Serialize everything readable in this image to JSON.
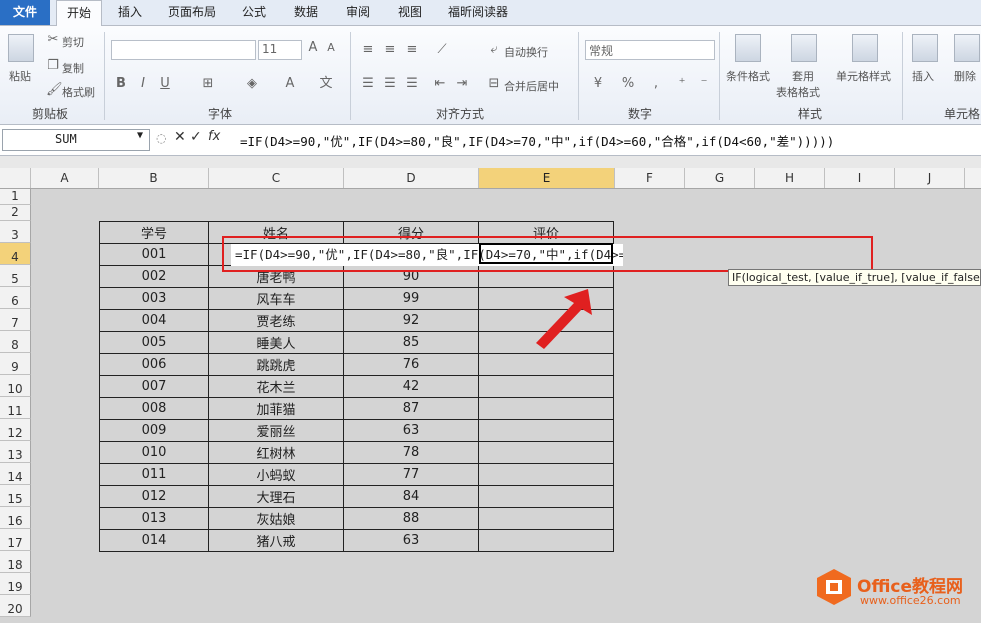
{
  "tabs": [
    "文件",
    "开始",
    "插入",
    "页面布局",
    "公式",
    "数据",
    "审阅",
    "视图",
    "福昕阅读器"
  ],
  "ribbon": {
    "clipboard": {
      "paste": "粘贴",
      "cut": "剪切",
      "copy": "复制",
      "format_painter": "格式刷",
      "group": "剪贴板"
    },
    "font": {
      "size": "11",
      "group": "字体"
    },
    "alignment": {
      "wrap": "自动换行",
      "merge": "合并后居中",
      "group": "对齐方式"
    },
    "number": {
      "format": "常规",
      "group": "数字"
    },
    "styles": {
      "conditional": "条件格式",
      "table_fmt_1": "套用",
      "table_fmt_2": "表格格式",
      "cell_styles": "单元格样式",
      "group": "样式"
    },
    "cells": {
      "insert": "插入",
      "delete": "删除",
      "group": "单元格"
    }
  },
  "formula_bar": {
    "name_box": "SUM",
    "formula": "=IF(D4>=90,\"优\",IF(D4>=80,\"良\",IF(D4>=70,\"中\",if(D4>=60,\"合格\",if(D4<60,\"差\")))))"
  },
  "columns": [
    "A",
    "B",
    "C",
    "D",
    "E",
    "F",
    "G",
    "H",
    "I",
    "J"
  ],
  "rows": [
    "1",
    "2",
    "3",
    "4",
    "5",
    "6",
    "7",
    "8",
    "9",
    "10",
    "11",
    "12",
    "13",
    "14",
    "15",
    "16",
    "17",
    "18",
    "19",
    "20"
  ],
  "table": {
    "headers": [
      "学号",
      "姓名",
      "得分",
      "评价"
    ],
    "rows": [
      [
        "001",
        "",
        "",
        ""
      ],
      [
        "002",
        "唐老鸭",
        "90",
        ""
      ],
      [
        "003",
        "风车车",
        "99",
        ""
      ],
      [
        "004",
        "贾老练",
        "92",
        ""
      ],
      [
        "005",
        "睡美人",
        "85",
        ""
      ],
      [
        "006",
        "跳跳虎",
        "76",
        ""
      ],
      [
        "007",
        "花木兰",
        "42",
        ""
      ],
      [
        "008",
        "加菲猫",
        "87",
        ""
      ],
      [
        "009",
        "爱丽丝",
        "63",
        ""
      ],
      [
        "010",
        "红树林",
        "78",
        ""
      ],
      [
        "011",
        "小蚂蚁",
        "77",
        ""
      ],
      [
        "012",
        "大理石",
        "84",
        ""
      ],
      [
        "013",
        "灰姑娘",
        "88",
        ""
      ],
      [
        "014",
        "猪八戒",
        "63",
        ""
      ]
    ]
  },
  "edit_cell": {
    "formula": "=IF(D4>=90,\"优\",IF(D4>=80,\"良\",IF(D4>=70,\"中\",if(D4>=60,\"合格\",if(D4<60,\"差\")))))"
  },
  "tooltip": {
    "text": "IF(logical_test, [value_if_true], [value_if_false])"
  },
  "watermark": {
    "brand": "Office教程网",
    "url": "www.office26.com"
  }
}
